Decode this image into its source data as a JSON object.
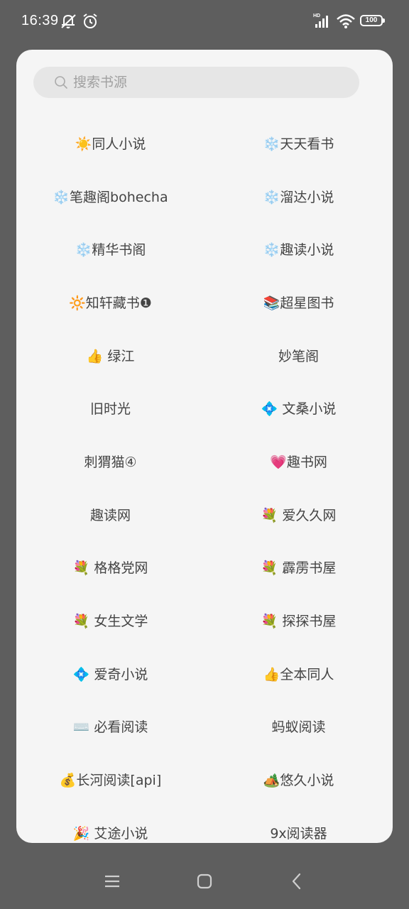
{
  "status_bar": {
    "time": "16:39",
    "network_label": "HD",
    "battery": "100"
  },
  "search": {
    "placeholder": "搜索书源",
    "value": ""
  },
  "sources": [
    {
      "label": "☀️同人小说"
    },
    {
      "label": "❄️天天看书"
    },
    {
      "label": "❄️笔趣阁bohecha"
    },
    {
      "label": "❄️溜达小说"
    },
    {
      "label": "❄️精华书阁"
    },
    {
      "label": "❄️趣读小说"
    },
    {
      "label": "🔆知轩藏书❶"
    },
    {
      "label": "📚超星图书"
    },
    {
      "label": "👍 绿江"
    },
    {
      "label": "妙笔阁"
    },
    {
      "label": "旧时光"
    },
    {
      "label": "💠 文桑小说"
    },
    {
      "label": "刺猬猫④"
    },
    {
      "label": "💗趣书网"
    },
    {
      "label": "趣读网"
    },
    {
      "label": "💐 爱久久网"
    },
    {
      "label": "💐 格格党网"
    },
    {
      "label": "💐 霹雳书屋"
    },
    {
      "label": "💐 女生文学"
    },
    {
      "label": "💐 探探书屋"
    },
    {
      "label": "💠 爱奇小说"
    },
    {
      "label": "👍全本同人"
    },
    {
      "label": "⌨️ 必看阅读"
    },
    {
      "label": "蚂蚁阅读"
    },
    {
      "label": "💰长河阅读[api]"
    },
    {
      "label": "🏕️悠久小说"
    },
    {
      "label": "🎉 艾途小说"
    },
    {
      "label": "9x阅读器"
    }
  ],
  "colors": {
    "dialog_bg": "#f5f5f5",
    "scrim": "#5e5e5e",
    "search_bg": "#e6e6e6"
  },
  "icons": {
    "nav_menu": "menu-icon",
    "nav_home": "home-icon",
    "nav_back": "back-icon"
  }
}
